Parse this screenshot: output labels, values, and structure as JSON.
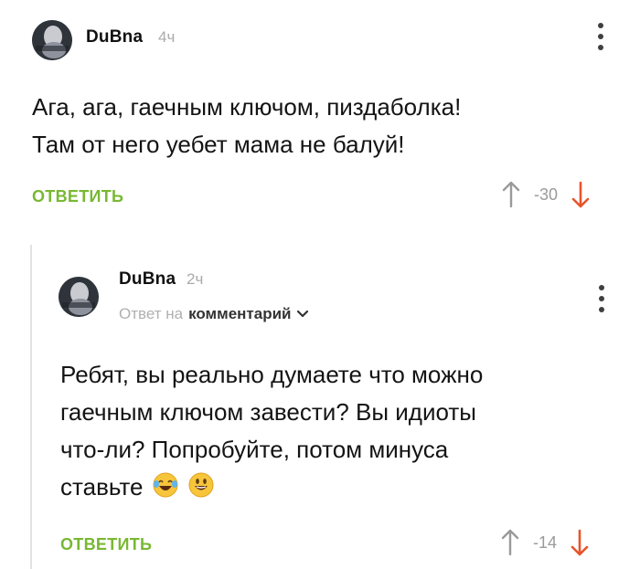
{
  "comment1": {
    "username": "DuBna",
    "time": "4ч",
    "text": "Ага, ага, гаечным ключом, пиздаболка!\nТам от него уебет мама не балуй!",
    "reply_label": "ОТВЕТИТЬ",
    "score": "-30"
  },
  "comment2": {
    "username": "DuBna",
    "time": "2ч",
    "reply_to_prefix": "Ответ на",
    "reply_to_target": "комментарий",
    "text": "Ребят, вы реально думаете что можно\nгаечным ключом завести? Вы идиоты\nчто-ли? Попробуйте, потом минуса\nставьте",
    "emojis": [
      "crying-laughing-emoji",
      "smiling-emoji"
    ],
    "reply_label": "ОТВЕТИТЬ",
    "score": "-14"
  },
  "colors": {
    "reply_green": "#79b833",
    "downvote_red": "#e8542b",
    "upvote_gray": "#9a9a9a",
    "thread_line": "#e2e2e2"
  }
}
